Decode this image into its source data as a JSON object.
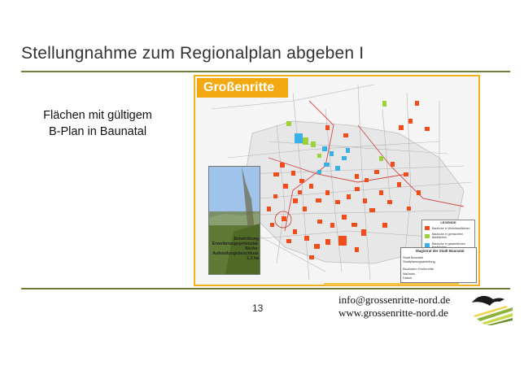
{
  "slide": {
    "title": "Stellungnahme zum Regionalplan abgeben I",
    "body_line1": "Flächen mit gültigem",
    "body_line2": "B-Plan in Baunatal",
    "page_number": "13",
    "email": "info@grossenritte-nord.de",
    "website": "www.grossenritte-nord.de"
  },
  "map": {
    "label": "Großenritte",
    "photo_caption": [
      "Entwicklung",
      "Erweiterungspotenzial-",
      "fläche:",
      "Aufstellungsbeschluss",
      "1,3 ha"
    ],
    "legend": {
      "title": "LEGENDE",
      "items": [
        {
          "label": "Baulücke in Wohnbauflächen",
          "color": "#f04d1c"
        },
        {
          "label": "Baulücke in gemischten Bauflächen",
          "color": "#9bd23c"
        },
        {
          "label": "Baulücke in gewerblichen Bauflächen",
          "color": "#3ab1e6"
        }
      ]
    },
    "titleblock": {
      "authority": "Magistrat der Stadt Baunatal",
      "line1": "Stadt Baunatal",
      "line2": "Stadtplanungsabteilung",
      "line3": "Baulücken Großenritte",
      "line4": "Maßstab",
      "line5": "Datum"
    }
  },
  "colors": {
    "rule": "#6e7d38",
    "map_border": "#f2b21c",
    "label_bg": "#f3a912"
  }
}
